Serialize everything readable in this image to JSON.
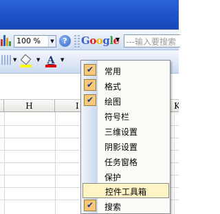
{
  "toolbar": {
    "zoom_value": "100 %",
    "help_glyph": "?",
    "google": {
      "logo_letters": [
        "G",
        "o",
        "o",
        "g",
        "l",
        "e"
      ],
      "search_placeholder": "---输入要搜索"
    },
    "font_color_glyph": "A"
  },
  "sheet": {
    "column_headers": [
      "H",
      "I",
      "K"
    ]
  },
  "menu": {
    "items": [
      {
        "label": "常用",
        "checked": true
      },
      {
        "label": "格式",
        "checked": true
      },
      {
        "label": "绘图",
        "checked": true
      },
      {
        "label": "符号栏",
        "checked": false
      },
      {
        "label": "三维设置",
        "checked": false
      },
      {
        "label": "阴影设置",
        "checked": false
      },
      {
        "label": "任务窗格",
        "checked": false
      },
      {
        "label": "保护",
        "checked": false
      },
      {
        "label": "控件工具箱",
        "checked": false,
        "highlighted": true
      },
      {
        "label": "搜索",
        "checked": true
      }
    ],
    "check_glyph": "✔"
  },
  "colors": {
    "title_bar": "#2b63d8",
    "toolbar_bg": "#dfe8f7",
    "menu_highlight": "#fff4c6",
    "check_bg": "#f7c77a"
  }
}
